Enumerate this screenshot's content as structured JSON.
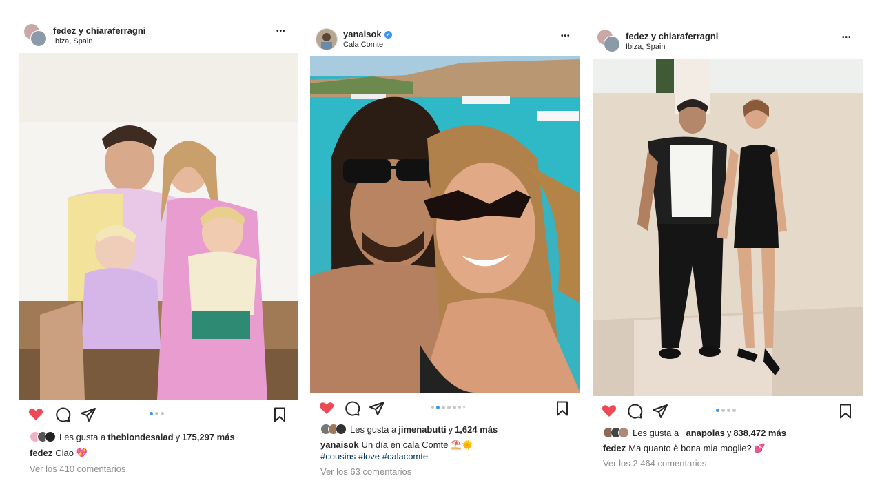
{
  "posts": [
    {
      "username": "fedez y chiaraferragni",
      "location": "Ibiza, Spain",
      "more": "•••",
      "likes_prefix": "Les gusta a",
      "likes_user": "theblondesalad",
      "likes_mid": "y",
      "likes_count": "175,297 más",
      "caption_user": "fedez",
      "caption_text": "Ciao 💖",
      "comments": "Ver los 410 comentarios",
      "carousel_total": 3,
      "carousel_active": 1
    },
    {
      "username": "yanaisok",
      "verified": true,
      "location": "Cala Comte",
      "more": "•••",
      "likes_prefix": "Les gusta a",
      "likes_user": "jimenabutti",
      "likes_mid": "y",
      "likes_count": "1,624 más",
      "caption_user": "yanaisok",
      "caption_text": "Un día en cala Comte ⛱️🌞",
      "hashtags": "#cousins #love #calacomte",
      "comments": "Ver los 63 comentarios",
      "carousel_total": 7,
      "carousel_active": 2
    },
    {
      "username": "fedez y chiaraferragni",
      "location": "Ibiza, Spain",
      "more": "•••",
      "likes_prefix": "Les gusta a",
      "likes_user": "_anapolas",
      "likes_mid": "y",
      "likes_count": "838,472 más",
      "caption_user": "fedez",
      "caption_text": "Ma quanto è bona mia moglie? 💕",
      "comments": "Ver los 2,464 comentarios",
      "carousel_total": 4,
      "carousel_active": 1
    }
  ],
  "colors": {
    "like_red": "#ed4956",
    "carousel_active": "#3897f0",
    "link_blue": "#00376b",
    "muted": "#8e8e8e"
  },
  "icons": [
    "heart-icon",
    "comment-icon",
    "share-icon",
    "bookmark-icon",
    "more-icon",
    "verified-icon"
  ]
}
